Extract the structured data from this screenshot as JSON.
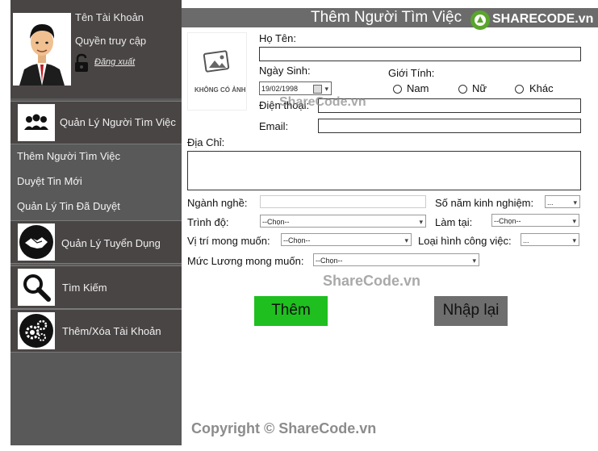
{
  "app": {
    "header_title": "Thêm Người Tìm Việc",
    "logo_text": "SHARECODE.vn"
  },
  "profile": {
    "account_name": "Tên Tài Khoản",
    "access_right": "Quyền truy cập",
    "logout": "Đăng xuất"
  },
  "sidebar": {
    "sections": [
      {
        "label": "Quản Lý Người Tìm Việc",
        "icon": "people-group-icon"
      },
      {
        "label": "Quản Lý Tuyển Dụng",
        "icon": "handshake-icon"
      },
      {
        "label": "Tìm Kiếm",
        "icon": "magnifier-icon"
      },
      {
        "label": "Thêm/Xóa Tài Khoản",
        "icon": "gears-icon"
      }
    ],
    "sub_items": [
      "Thêm Người Tìm Việc",
      "Duyệt Tin Mới",
      "Quản Lý Tin Đã Duyệt"
    ]
  },
  "form": {
    "photo_placeholder": "KHÔNG CÓ ẢNH",
    "name_label": "Họ Tên:",
    "dob_label": "Ngày Sinh:",
    "dob_value": "19/02/1998",
    "gender_label": "Giới Tính:",
    "gender_options": [
      "Nam",
      "Nữ",
      "Khác"
    ],
    "phone_label": "Điện thoại:",
    "email_label": "Email:",
    "address_label": "Địa Chỉ:",
    "career_label": "Ngành nghề:",
    "experience_label": "Số năm kinh nghiệm:",
    "experience_value": "...",
    "level_label": "Trình độ:",
    "level_value": "--Chọn--",
    "workplace_label": "Làm tại:",
    "workplace_value": "--Chọn--",
    "position_label": "Vị trí mong muốn:",
    "position_value": "--Chọn--",
    "jobtype_label": "Loại hình công việc:",
    "jobtype_value": "...",
    "salary_label": "Mức Lương mong muốn:",
    "salary_value": "--Chọn--",
    "add_button": "Thêm",
    "reset_button": "Nhập lại"
  },
  "watermarks": [
    "ShareCode.vn",
    "ShareCode.vn",
    "Copyright © ShareCode.vn"
  ],
  "colors": {
    "sidebar_bg": "#595959",
    "menu_bg": "#4a4545",
    "header_bg": "#6b6b6b",
    "add_button_bg": "#1fbf1f",
    "reset_button_bg": "#6e6e6e",
    "logo_green": "#5aa52c"
  }
}
